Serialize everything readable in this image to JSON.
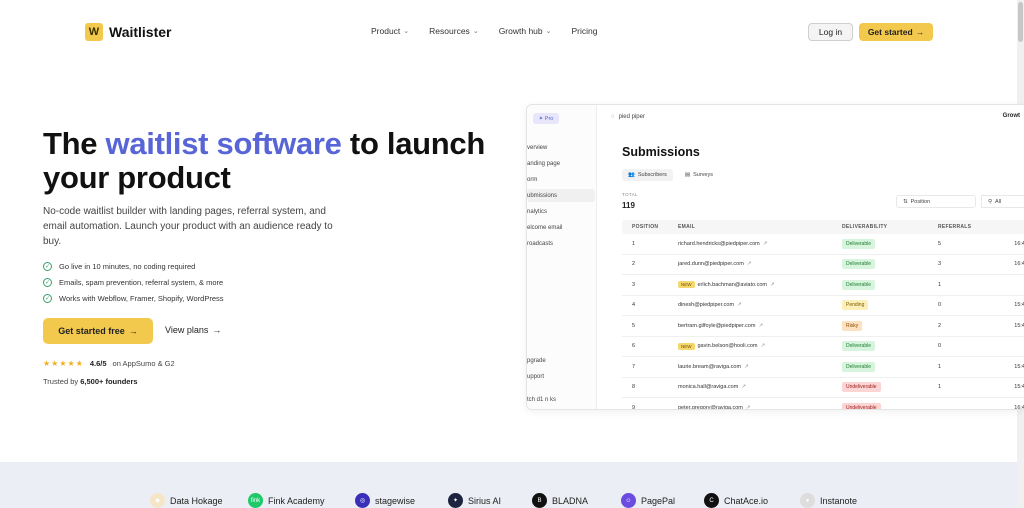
{
  "nav": {
    "brand": "Waitlister",
    "brand_mark": "W",
    "links": [
      {
        "label": "Product",
        "has_menu": true
      },
      {
        "label": "Resources",
        "has_menu": true
      },
      {
        "label": "Growth hub",
        "has_menu": true
      },
      {
        "label": "Pricing",
        "has_menu": false
      }
    ],
    "login_label": "Log in",
    "get_started_label": "Get started",
    "arrow": "→",
    "chevron": "⌄"
  },
  "hero": {
    "title_pre": "The ",
    "title_accent": "waitlist software",
    "title_post": " to launch your product",
    "subtitle": "No-code waitlist builder with landing pages, referral system, and email automation. Launch your product with an audience ready to buy.",
    "features": [
      "Go live in 10 minutes, no coding required",
      "Emails, spam prevention, referral system, & more",
      "Works with Webflow, Framer, Shopify, WordPress"
    ],
    "cta_primary": "Get started free",
    "cta_secondary": "View plans",
    "stars": "★★★★★",
    "rating_score": "4.6/5",
    "rating_source": "on AppSumo & G2",
    "trusted_pre": "Trusted by ",
    "trusted_count": "6,500+ founders"
  },
  "dashboard": {
    "pro_label": "✦ Pro",
    "workspace": "pied piper",
    "growth_label": "Growt",
    "sidebar": [
      "verview",
      "anding page",
      "orm",
      "ubmissions",
      "nalytics",
      "elcome email",
      "roadcasts"
    ],
    "sidebar_bottom": [
      "pgrade",
      "upport",
      "tch  d1  n  ks"
    ],
    "title": "Submissions",
    "tabs": [
      "Subscribers",
      "Surveys"
    ],
    "total_label": "TOTAL",
    "total_value": "119",
    "filter_position": "Position",
    "filter_all": "All",
    "columns": [
      "POSITION",
      "EMAIL",
      "DELIVERABILITY",
      "REFERRALS"
    ],
    "rows": [
      {
        "pos": "1",
        "new": false,
        "email": "richard.hendricks@piedpiper.com",
        "status": "Deliverable",
        "tone": "green",
        "refs": "5",
        "date": "16:4"
      },
      {
        "pos": "2",
        "new": false,
        "email": "jared.dunn@piedpiper.com",
        "status": "Deliverable",
        "tone": "green",
        "refs": "3",
        "date": "16:4"
      },
      {
        "pos": "3",
        "new": true,
        "email": "erlich.bachman@aviato.com",
        "status": "Deliverable",
        "tone": "green",
        "refs": "1",
        "date": ""
      },
      {
        "pos": "4",
        "new": false,
        "email": "dinesh@piedpiper.com",
        "status": "Pending",
        "tone": "yellow",
        "refs": "0",
        "date": "15:4"
      },
      {
        "pos": "5",
        "new": false,
        "email": "bertram.gilfoyle@piedpiper.com",
        "status": "Risky",
        "tone": "orange",
        "refs": "2",
        "date": "15:4"
      },
      {
        "pos": "6",
        "new": true,
        "email": "gavin.belson@hooli.com",
        "status": "Deliverable",
        "tone": "green",
        "refs": "0",
        "date": ""
      },
      {
        "pos": "7",
        "new": false,
        "email": "laurie.bream@raviga.com",
        "status": "Deliverable",
        "tone": "green",
        "refs": "1",
        "date": "15:4"
      },
      {
        "pos": "8",
        "new": false,
        "email": "monica.hall@raviga.com",
        "status": "Undeliverable",
        "tone": "red",
        "refs": "1",
        "date": "15:4"
      },
      {
        "pos": "9",
        "new": false,
        "email": "peter.gregory@raviga.com",
        "status": "Undeliverable",
        "tone": "red",
        "refs": "",
        "date": "16:4"
      }
    ]
  },
  "logos": [
    {
      "name": "Data Hokage",
      "mark": "◆",
      "color": "#f5e6c8"
    },
    {
      "name": "Fink Academy",
      "mark": "fink",
      "color": "#1fc96a"
    },
    {
      "name": "stagewise",
      "mark": "◎",
      "color": "#3a2fb8"
    },
    {
      "name": "Sirius AI",
      "mark": "✦",
      "color": "#1d2440"
    },
    {
      "name": "BLADNA",
      "mark": "B",
      "color": "#111111"
    },
    {
      "name": "PagePal",
      "mark": "☺",
      "color": "#6a4ce0"
    },
    {
      "name": "ChatAce.io",
      "mark": "C",
      "color": "#111111"
    },
    {
      "name": "Instanote",
      "mark": "●",
      "color": "#dddddd"
    }
  ],
  "colors": {
    "accent": "#5865d6",
    "brand_yellow": "#f2c94c"
  }
}
